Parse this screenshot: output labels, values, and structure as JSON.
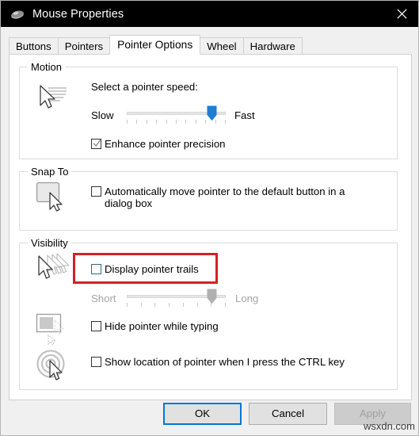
{
  "window": {
    "title": "Mouse Properties",
    "icon": "mouse-icon",
    "close_label": "✕"
  },
  "tabs": [
    {
      "label": "Buttons",
      "selected": false
    },
    {
      "label": "Pointers",
      "selected": false
    },
    {
      "label": "Pointer Options",
      "selected": true
    },
    {
      "label": "Wheel",
      "selected": false
    },
    {
      "label": "Hardware",
      "selected": false
    }
  ],
  "groups": {
    "motion": {
      "title": "Motion",
      "icon": "pointer-speed-icon",
      "speed_label": "Select a pointer speed:",
      "slider": {
        "min_label": "Slow",
        "max_label": "Fast",
        "value_percent": 86,
        "tick_count": 10,
        "enabled": true,
        "thumb_color": "#1b7fd4"
      },
      "enhance_precision": {
        "label": "Enhance pointer precision",
        "checked": true
      }
    },
    "snap_to": {
      "title": "Snap To",
      "icon": "snap-to-button-icon",
      "auto_move": {
        "label": "Automatically move pointer to the default button in a dialog box",
        "checked": false
      }
    },
    "visibility": {
      "title": "Visibility",
      "trails": {
        "icon": "pointer-trails-icon",
        "label": "Display pointer trails",
        "checked": false,
        "highlighted": true,
        "highlight_color": "#d62027"
      },
      "trails_slider": {
        "min_label": "Short",
        "max_label": "Long",
        "value_percent": 86,
        "tick_count": 7,
        "enabled": false,
        "thumb_color": "#b0b0b0"
      },
      "hide_while_typing": {
        "icon": "hide-pointer-typing-icon",
        "label": "Hide pointer while typing",
        "checked": false
      },
      "show_location": {
        "icon": "show-pointer-location-icon",
        "label": "Show location of pointer when I press the CTRL key",
        "checked": false
      }
    }
  },
  "buttons": {
    "ok": {
      "label": "OK",
      "enabled": true,
      "focused": true
    },
    "cancel": {
      "label": "Cancel",
      "enabled": true,
      "focused": false
    },
    "apply": {
      "label": "Apply",
      "enabled": false,
      "focused": false
    }
  },
  "watermark": {
    "text": "wsxdn.com"
  }
}
